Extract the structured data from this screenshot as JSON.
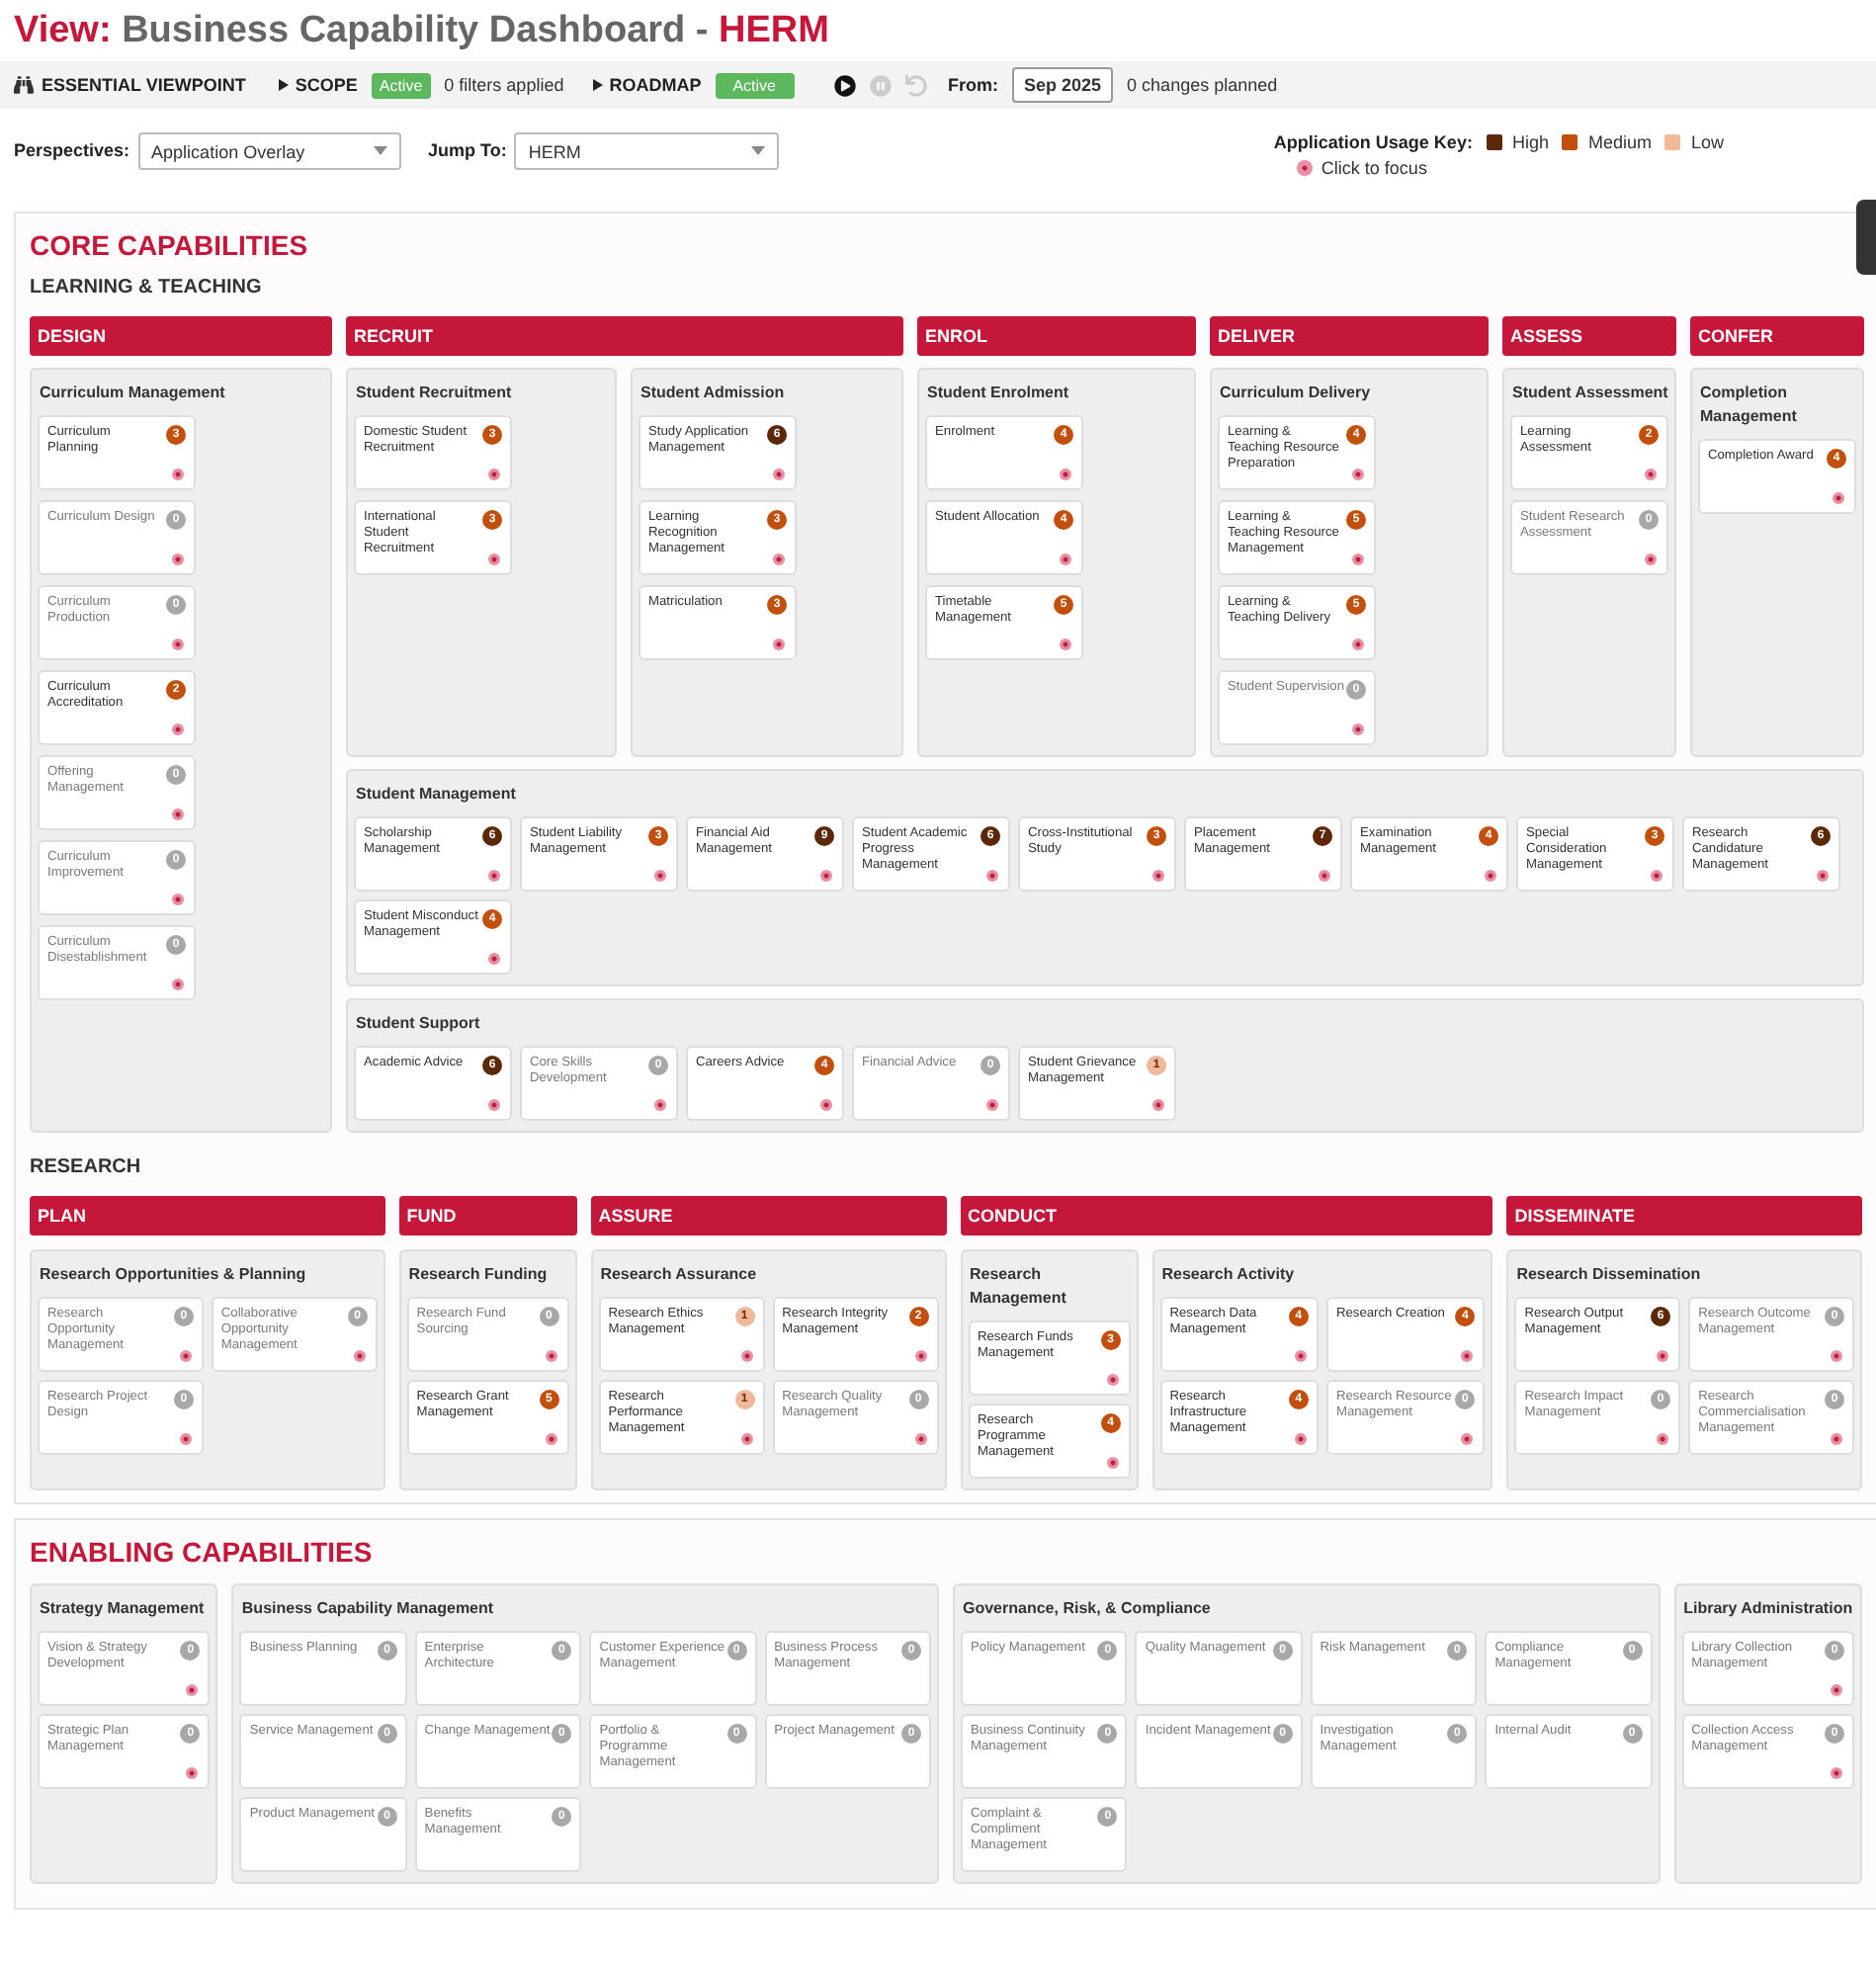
{
  "title": {
    "prefix": "View:",
    "name": "Business Capability Dashboard -",
    "suffix": "HERM"
  },
  "toolbar": {
    "brand": "ESSENTIAL VIEWPOINT",
    "scope": {
      "label": "SCOPE",
      "badge": "Active",
      "active": true,
      "info": "0 filters applied"
    },
    "roadmap": {
      "label": "ROADMAP",
      "badge": "Active",
      "active": true
    },
    "controls": [
      {
        "kind": "play",
        "disabled": false
      },
      {
        "kind": "pause",
        "disabled": true
      },
      {
        "kind": "reset",
        "disabled": true
      }
    ],
    "from": {
      "label": "From:",
      "value": "Sep 2025"
    },
    "changes": "0 changes planned"
  },
  "filters": {
    "perspectives": {
      "label": "Perspectives:",
      "value": "Application Overlay"
    },
    "jump_to": {
      "label": "Jump To:",
      "value": "HERM"
    }
  },
  "legend": {
    "title": "Application Usage Key:",
    "items": [
      {
        "label": "High",
        "color": "#5c2808"
      },
      {
        "label": "Medium",
        "color": "#c2500c"
      },
      {
        "label": "Low",
        "color": "#f0b999"
      }
    ],
    "focus_hint": "Click to focus"
  },
  "core": {
    "title": "CORE CAPABILITIES",
    "learning_teaching": {
      "title": "LEARNING & TEACHING",
      "stages": [
        {
          "label": "DESIGN",
          "groups": [
            {
              "name": "Curriculum Management",
              "focus_dots": true,
              "cards": [
                {
                  "name": "Curriculum Planning",
                  "count": "3",
                  "color": "#c2500c"
                },
                {
                  "name": "Curriculum Design",
                  "count": "0",
                  "color": "#a8a8a8"
                },
                {
                  "name": "Curriculum Production",
                  "count": "0",
                  "color": "#a8a8a8"
                },
                {
                  "name": "Curriculum Accreditation",
                  "count": "2",
                  "color": "#c2500c"
                },
                {
                  "name": "Offering Management",
                  "count": "0",
                  "color": "#a8a8a8"
                },
                {
                  "name": "Curriculum Improvement",
                  "count": "0",
                  "color": "#a8a8a8"
                },
                {
                  "name": "Curriculum Disestablishment",
                  "count": "0",
                  "color": "#a8a8a8"
                }
              ]
            }
          ]
        },
        {
          "label": "RECRUIT",
          "groups": [
            {
              "name": "Student Recruitment",
              "focus_dots": true,
              "cards": [
                {
                  "name": "Domestic Student Recruitment",
                  "count": "3",
                  "color": "#c2500c"
                },
                {
                  "name": "International Student Recruitment",
                  "count": "3",
                  "color": "#c2500c"
                }
              ]
            },
            {
              "name": "Student Admission",
              "focus_dots": true,
              "cards": [
                {
                  "name": "Study Application Management",
                  "count": "6",
                  "color": "#5c2808"
                },
                {
                  "name": "Learning Recognition Management",
                  "count": "3",
                  "color": "#c2500c"
                },
                {
                  "name": "Matriculation",
                  "count": "3",
                  "color": "#c2500c"
                }
              ]
            }
          ]
        },
        {
          "label": "ENROL",
          "groups": [
            {
              "name": "Student Enrolment",
              "focus_dots": true,
              "cards": [
                {
                  "name": "Enrolment",
                  "count": "4",
                  "color": "#c2500c"
                },
                {
                  "name": "Student Allocation",
                  "count": "4",
                  "color": "#c2500c"
                },
                {
                  "name": "Timetable Management",
                  "count": "5",
                  "color": "#c2500c"
                }
              ]
            }
          ]
        },
        {
          "label": "DELIVER",
          "groups": [
            {
              "name": "Curriculum Delivery",
              "focus_dots": true,
              "cards": [
                {
                  "name": "Learning & Teaching Resource Preparation",
                  "count": "4",
                  "color": "#c2500c"
                },
                {
                  "name": "Learning & Teaching Resource Management",
                  "count": "5",
                  "color": "#c2500c"
                },
                {
                  "name": "Learning & Teaching Delivery",
                  "count": "5",
                  "color": "#c2500c"
                },
                {
                  "name": "Student Supervision",
                  "count": "0",
                  "color": "#a8a8a8"
                }
              ]
            }
          ]
        },
        {
          "label": "ASSESS",
          "groups": [
            {
              "name": "Student Assessment",
              "focus_dots": true,
              "cards": [
                {
                  "name": "Learning Assessment",
                  "count": "2",
                  "color": "#c2500c"
                },
                {
                  "name": "Student Research Assessment",
                  "count": "0",
                  "color": "#a8a8a8"
                }
              ]
            }
          ]
        },
        {
          "label": "CONFER",
          "groups": [
            {
              "name": "Completion Management",
              "focus_dots": true,
              "cards": [
                {
                  "name": "Completion Award",
                  "count": "4",
                  "color": "#c2500c"
                }
              ]
            }
          ]
        }
      ],
      "shared_groups": [
        {
          "name": "Student Management",
          "focus_dots": true,
          "cards": [
            {
              "name": "Scholarship Management",
              "count": "6",
              "color": "#5c2808"
            },
            {
              "name": "Student Liability Management",
              "count": "3",
              "color": "#c2500c"
            },
            {
              "name": "Financial Aid Management",
              "count": "9",
              "color": "#5c2808"
            },
            {
              "name": "Student Academic Progress Management",
              "count": "6",
              "color": "#5c2808"
            },
            {
              "name": "Cross-Institutional Study",
              "count": "3",
              "color": "#c2500c"
            },
            {
              "name": "Placement Management",
              "count": "7",
              "color": "#5c2808"
            },
            {
              "name": "Examination Management",
              "count": "4",
              "color": "#c2500c"
            },
            {
              "name": "Special Consideration Management",
              "count": "3",
              "color": "#c2500c"
            },
            {
              "name": "Research Candidature Management",
              "count": "6",
              "color": "#5c2808"
            },
            {
              "name": "Student Misconduct Management",
              "count": "4",
              "color": "#c2500c"
            }
          ]
        },
        {
          "name": "Student Support",
          "focus_dots": true,
          "cards": [
            {
              "name": "Academic Advice",
              "count": "6",
              "color": "#5c2808"
            },
            {
              "name": "Core Skills Development",
              "count": "0",
              "color": "#a8a8a8"
            },
            {
              "name": "Careers Advice",
              "count": "4",
              "color": "#c2500c"
            },
            {
              "name": "Financial Advice",
              "count": "0",
              "color": "#a8a8a8"
            },
            {
              "name": "Student Grievance Management",
              "count": "1",
              "color": "#f0b999"
            }
          ]
        }
      ]
    },
    "research": {
      "title": "RESEARCH",
      "stages": [
        {
          "label": "PLAN",
          "groups": [
            {
              "name": "Research Opportunities & Planning",
              "focus_dots": true,
              "cards": [
                {
                  "name": "Research Opportunity Management",
                  "count": "0",
                  "color": "#a8a8a8"
                },
                {
                  "name": "Collaborative Opportunity Management",
                  "count": "0",
                  "color": "#a8a8a8"
                },
                {
                  "name": "Research Project Design",
                  "count": "0",
                  "color": "#a8a8a8"
                }
              ]
            }
          ]
        },
        {
          "label": "FUND",
          "groups": [
            {
              "name": "Research Funding",
              "focus_dots": true,
              "cards": [
                {
                  "name": "Research Fund Sourcing",
                  "count": "0",
                  "color": "#a8a8a8"
                },
                {
                  "name": "Research Grant Management",
                  "count": "5",
                  "color": "#c2500c"
                }
              ]
            }
          ]
        },
        {
          "label": "ASSURE",
          "groups": [
            {
              "name": "Research Assurance",
              "focus_dots": true,
              "cards": [
                {
                  "name": "Research Ethics Management",
                  "count": "1",
                  "color": "#f0b999"
                },
                {
                  "name": "Research Integrity Management",
                  "count": "2",
                  "color": "#c2500c"
                },
                {
                  "name": "Research Performance Management",
                  "count": "1",
                  "color": "#f0b999"
                },
                {
                  "name": "Research Quality Management",
                  "count": "0",
                  "color": "#a8a8a8"
                }
              ]
            }
          ]
        },
        {
          "label": "CONDUCT",
          "groups": [
            {
              "name": "Research Management",
              "focus_dots": true,
              "cards": [
                {
                  "name": "Research Funds Management",
                  "count": "3",
                  "color": "#c2500c"
                },
                {
                  "name": "Research Programme Management",
                  "count": "4",
                  "color": "#c2500c"
                }
              ]
            },
            {
              "name": "Research Activity",
              "focus_dots": true,
              "cards": [
                {
                  "name": "Research Data Management",
                  "count": "4",
                  "color": "#c2500c"
                },
                {
                  "name": "Research Creation",
                  "count": "4",
                  "color": "#c2500c"
                },
                {
                  "name": "Research Infrastructure Management",
                  "count": "4",
                  "color": "#c2500c"
                },
                {
                  "name": "Research Resource Management",
                  "count": "0",
                  "color": "#a8a8a8"
                }
              ]
            }
          ]
        },
        {
          "label": "DISSEMINATE",
          "groups": [
            {
              "name": "Research Dissemination",
              "focus_dots": true,
              "cards": [
                {
                  "name": "Research Output Management",
                  "count": "6",
                  "color": "#5c2808"
                },
                {
                  "name": "Research Outcome Management",
                  "count": "0",
                  "color": "#a8a8a8"
                },
                {
                  "name": "Research Impact Management",
                  "count": "0",
                  "color": "#a8a8a8"
                },
                {
                  "name": "Research Commercialisation Management",
                  "count": "0",
                  "color": "#a8a8a8"
                }
              ]
            }
          ]
        }
      ]
    }
  },
  "enabling": {
    "title": "ENABLING CAPABILITIES",
    "groups": [
      {
        "name": "Strategy Management",
        "focus_dots": true,
        "cards": [
          {
            "name": "Vision & Strategy Development",
            "count": "0",
            "color": "#a8a8a8"
          },
          {
            "name": "Strategic Plan Management",
            "count": "0",
            "color": "#a8a8a8"
          }
        ]
      },
      {
        "name": "Business Capability Management",
        "focus_dots": false,
        "cards": [
          {
            "name": "Business Planning",
            "count": "0",
            "color": "#a8a8a8"
          },
          {
            "name": "Enterprise Architecture",
            "count": "0",
            "color": "#a8a8a8"
          },
          {
            "name": "Customer Experience Management",
            "count": "0",
            "color": "#a8a8a8"
          },
          {
            "name": "Business Process Management",
            "count": "0",
            "color": "#a8a8a8"
          },
          {
            "name": "Service Management",
            "count": "0",
            "color": "#a8a8a8"
          },
          {
            "name": "Change Management",
            "count": "0",
            "color": "#a8a8a8"
          },
          {
            "name": "Portfolio & Programme Management",
            "count": "0",
            "color": "#a8a8a8"
          },
          {
            "name": "Project Management",
            "count": "0",
            "color": "#a8a8a8"
          },
          {
            "name": "Product Management",
            "count": "0",
            "color": "#a8a8a8"
          },
          {
            "name": "Benefits Management",
            "count": "0",
            "color": "#a8a8a8"
          }
        ]
      },
      {
        "name": "Governance, Risk, & Compliance",
        "focus_dots": false,
        "cards": [
          {
            "name": "Policy Management",
            "count": "0",
            "color": "#a8a8a8"
          },
          {
            "name": "Quality Management",
            "count": "0",
            "color": "#a8a8a8"
          },
          {
            "name": "Risk Management",
            "count": "0",
            "color": "#a8a8a8"
          },
          {
            "name": "Compliance Management",
            "count": "0",
            "color": "#a8a8a8"
          },
          {
            "name": "Business Continuity Management",
            "count": "0",
            "color": "#a8a8a8"
          },
          {
            "name": "Incident Management",
            "count": "0",
            "color": "#a8a8a8"
          },
          {
            "name": "Investigation Management",
            "count": "0",
            "color": "#a8a8a8"
          },
          {
            "name": "Internal Audit",
            "count": "0",
            "color": "#a8a8a8"
          },
          {
            "name": "Complaint & Compliment Management",
            "count": "0",
            "color": "#a8a8a8"
          }
        ]
      },
      {
        "name": "Library Administration",
        "focus_dots": true,
        "cards": [
          {
            "name": "Library Collection Management",
            "count": "0",
            "color": "#a8a8a8"
          },
          {
            "name": "Collection Access Management",
            "count": "0",
            "color": "#a8a8a8"
          }
        ]
      }
    ]
  }
}
